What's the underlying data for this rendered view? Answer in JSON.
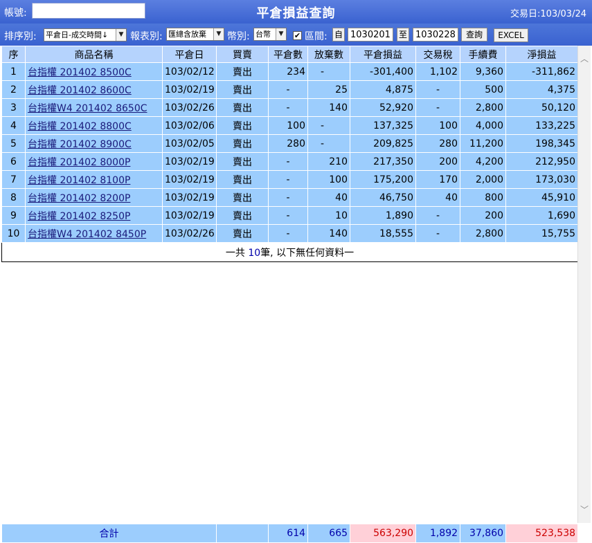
{
  "header": {
    "account_label": "帳號:",
    "account_value": "",
    "title": "平倉損益查詢",
    "trade_date_label": "交易日:",
    "trade_date": "103/03/24"
  },
  "filter": {
    "sort_label": "排序別:",
    "sort_value": "平倉日-成交時間↓",
    "report_label": "報表別:",
    "report_value": "匯總含放棄",
    "currency_label": "幣別:",
    "currency_value": "台幣",
    "range_checked": true,
    "range_label": "區間:",
    "from_label": "自",
    "from_value": "1030201",
    "to_label": "至",
    "to_value": "1030228",
    "query_label": "查詢",
    "excel_label": "EXCEL"
  },
  "table": {
    "columns": [
      "序",
      "商品名稱",
      "平倉日",
      "買賣",
      "平倉數",
      "放棄數",
      "平倉損益",
      "交易稅",
      "手續費",
      "淨損益"
    ],
    "rows": [
      {
        "no": "1",
        "product": "台指權 201402 8500C",
        "date": "103/02/12",
        "side": "賣出",
        "close_qty": "234",
        "abandon_qty": "-",
        "pl": "-301,400",
        "tax": "1,102",
        "fee": "9,360",
        "net": "-311,862"
      },
      {
        "no": "2",
        "product": "台指權 201402 8600C",
        "date": "103/02/19",
        "side": "賣出",
        "close_qty": "-",
        "abandon_qty": "25",
        "pl": "4,875",
        "tax": "-",
        "fee": "500",
        "net": "4,375"
      },
      {
        "no": "3",
        "product": "台指權W4 201402 8650C",
        "date": "103/02/26",
        "side": "賣出",
        "close_qty": "-",
        "abandon_qty": "140",
        "pl": "52,920",
        "tax": "-",
        "fee": "2,800",
        "net": "50,120"
      },
      {
        "no": "4",
        "product": "台指權 201402 8800C",
        "date": "103/02/06",
        "side": "賣出",
        "close_qty": "100",
        "abandon_qty": "-",
        "pl": "137,325",
        "tax": "100",
        "fee": "4,000",
        "net": "133,225"
      },
      {
        "no": "5",
        "product": "台指權 201402 8900C",
        "date": "103/02/05",
        "side": "賣出",
        "close_qty": "280",
        "abandon_qty": "-",
        "pl": "209,825",
        "tax": "280",
        "fee": "11,200",
        "net": "198,345"
      },
      {
        "no": "6",
        "product": "台指權 201402 8000P",
        "date": "103/02/19",
        "side": "賣出",
        "close_qty": "-",
        "abandon_qty": "210",
        "pl": "217,350",
        "tax": "200",
        "fee": "4,200",
        "net": "212,950"
      },
      {
        "no": "7",
        "product": "台指權 201402 8100P",
        "date": "103/02/19",
        "side": "賣出",
        "close_qty": "-",
        "abandon_qty": "100",
        "pl": "175,200",
        "tax": "170",
        "fee": "2,000",
        "net": "173,030"
      },
      {
        "no": "8",
        "product": "台指權 201402 8200P",
        "date": "103/02/19",
        "side": "賣出",
        "close_qty": "-",
        "abandon_qty": "40",
        "pl": "46,750",
        "tax": "40",
        "fee": "800",
        "net": "45,910"
      },
      {
        "no": "9",
        "product": "台指權 201402 8250P",
        "date": "103/02/19",
        "side": "賣出",
        "close_qty": "-",
        "abandon_qty": "10",
        "pl": "1,890",
        "tax": "-",
        "fee": "200",
        "net": "1,690"
      },
      {
        "no": "10",
        "product": "台指權W4 201402 8450P",
        "date": "103/02/26",
        "side": "賣出",
        "close_qty": "-",
        "abandon_qty": "140",
        "pl": "18,555",
        "tax": "-",
        "fee": "2,800",
        "net": "15,755"
      }
    ],
    "summary_prefix": "一共 ",
    "summary_count": "10",
    "summary_suffix": "筆, 以下無任何資料一"
  },
  "totals": {
    "label": "合計",
    "close_qty": "614",
    "abandon_qty": "665",
    "pl": "563,290",
    "tax": "1,892",
    "fee": "37,860",
    "net": "523,538"
  },
  "colors": {
    "header_blue": "#3a62d0",
    "row_blue": "#9ccdfd",
    "header_cell": "#b5d3fd",
    "total_pink": "#ffd0d8",
    "total_text": "#0000aa"
  },
  "icons": {
    "dropdown": "chevron-down-icon",
    "checkbox": "check-icon",
    "scroll_up": "scroll-up-icon",
    "scroll_down": "scroll-down-icon"
  }
}
